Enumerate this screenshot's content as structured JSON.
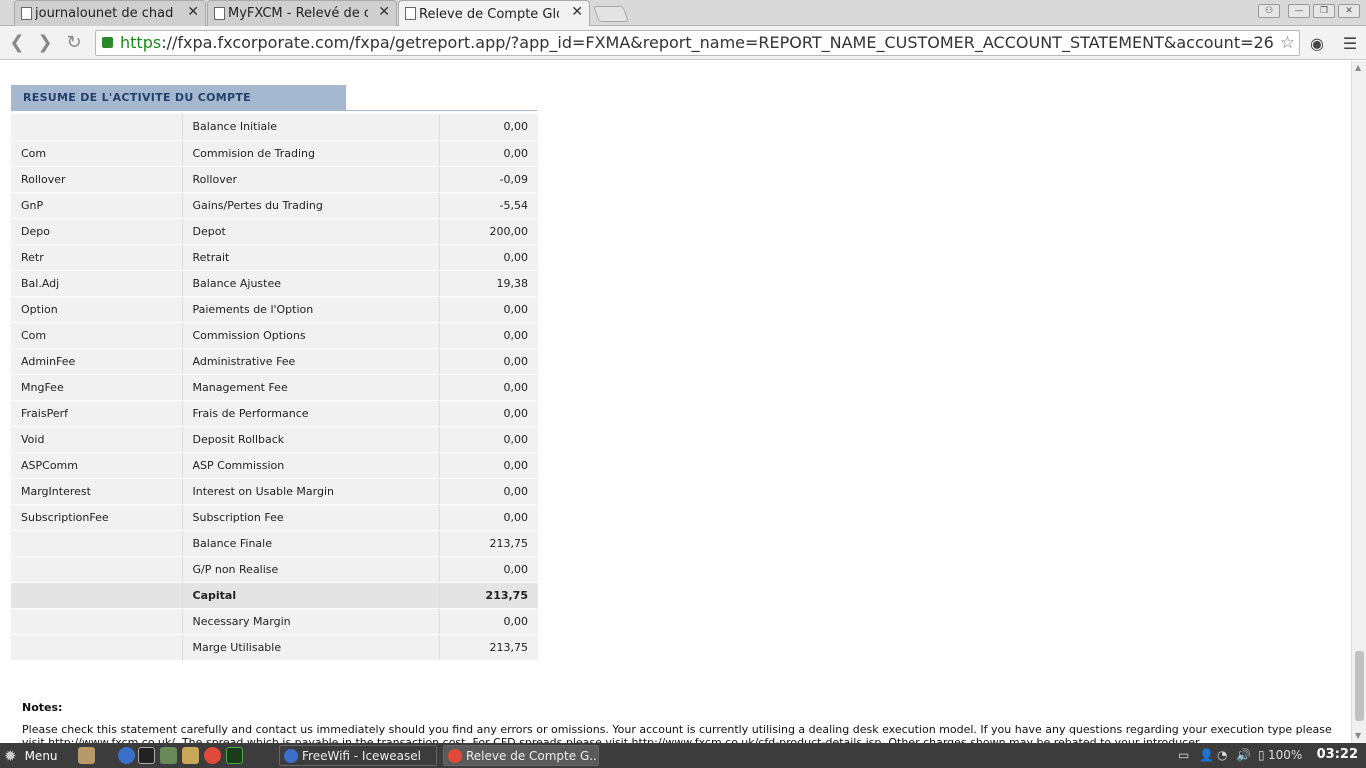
{
  "browser": {
    "tabs": [
      {
        "title": "journalounet de chad"
      },
      {
        "title": "MyFXCM - Relevé de co"
      },
      {
        "title": "Releve de Compte Glo"
      }
    ],
    "url_scheme": "https",
    "url_rest": "://fxpa.fxcorporate.com/fxpa/getreport.app/?app_id=FXMA&report_name=REPORT_NAME_CUSTOMER_ACCOUNT_STATEMENT&account=26"
  },
  "report": {
    "section_title": "RESUME DE L'ACTIVITE DU COMPTE",
    "rows": [
      {
        "code": "",
        "label": "Balance Initiale",
        "value": "0,00"
      },
      {
        "code": "Com",
        "label": "Commision de Trading",
        "value": "0,00"
      },
      {
        "code": "Rollover",
        "label": "Rollover",
        "value": "-0,09"
      },
      {
        "code": "GnP",
        "label": "Gains/Pertes du Trading",
        "value": "-5,54"
      },
      {
        "code": "Depo",
        "label": "Depot",
        "value": "200,00"
      },
      {
        "code": "Retr",
        "label": "Retrait",
        "value": "0,00"
      },
      {
        "code": "Bal.Adj",
        "label": "Balance Ajustee",
        "value": "19,38"
      },
      {
        "code": "Option",
        "label": "Paiements de l'Option",
        "value": "0,00"
      },
      {
        "code": "Com",
        "label": "Commission Options",
        "value": "0,00"
      },
      {
        "code": "AdminFee",
        "label": "Administrative Fee",
        "value": "0,00"
      },
      {
        "code": "MngFee",
        "label": "Management Fee",
        "value": "0,00"
      },
      {
        "code": "FraisPerf",
        "label": "Frais de Performance",
        "value": "0,00"
      },
      {
        "code": "Void",
        "label": "Deposit Rollback",
        "value": "0,00"
      },
      {
        "code": "ASPComm",
        "label": "ASP Commission",
        "value": "0,00"
      },
      {
        "code": "MargInterest",
        "label": "Interest on Usable Margin",
        "value": "0,00"
      },
      {
        "code": "SubscriptionFee",
        "label": "Subscription Fee",
        "value": "0,00"
      },
      {
        "code": "",
        "label": "Balance Finale",
        "value": "213,75"
      },
      {
        "code": "",
        "label": "G/P non Realise",
        "value": "0,00"
      },
      {
        "code": "",
        "label": "Capital",
        "value": "213,75",
        "bold": true
      },
      {
        "code": "",
        "label": "Necessary Margin",
        "value": "0,00"
      },
      {
        "code": "",
        "label": "Marge Utilisable",
        "value": "213,75"
      }
    ],
    "notes_title": "Notes:",
    "notes_text": "Please check this statement carefully and contact us immediately should you find any errors or omissions. Your account is currently utilising a dealing desk execution model. If you have any questions regarding your execution type please visit http://www.fxcm.co.uk/. The spread which is payable in the transaction cost. For CFD spreads please visit http://www.fxcm.co.uk/cfd-product-details.jsp. Other charges shown may be rebated to your introducer."
  },
  "taskbar": {
    "menu_label": "Menu",
    "tasks": [
      {
        "label": "FreeWifi - Iceweasel"
      },
      {
        "label": "Releve de Compte G..."
      }
    ],
    "battery": "100%",
    "clock": "03:22"
  },
  "colors": {
    "section_header_bg": "#a6b8cf",
    "section_header_text": "#21416d",
    "row_bg": "#f1f1f1",
    "total_row_bg": "#e4e4e4",
    "https_green": "#1a8a1a",
    "taskbar_bg": "#3c3c3c"
  }
}
